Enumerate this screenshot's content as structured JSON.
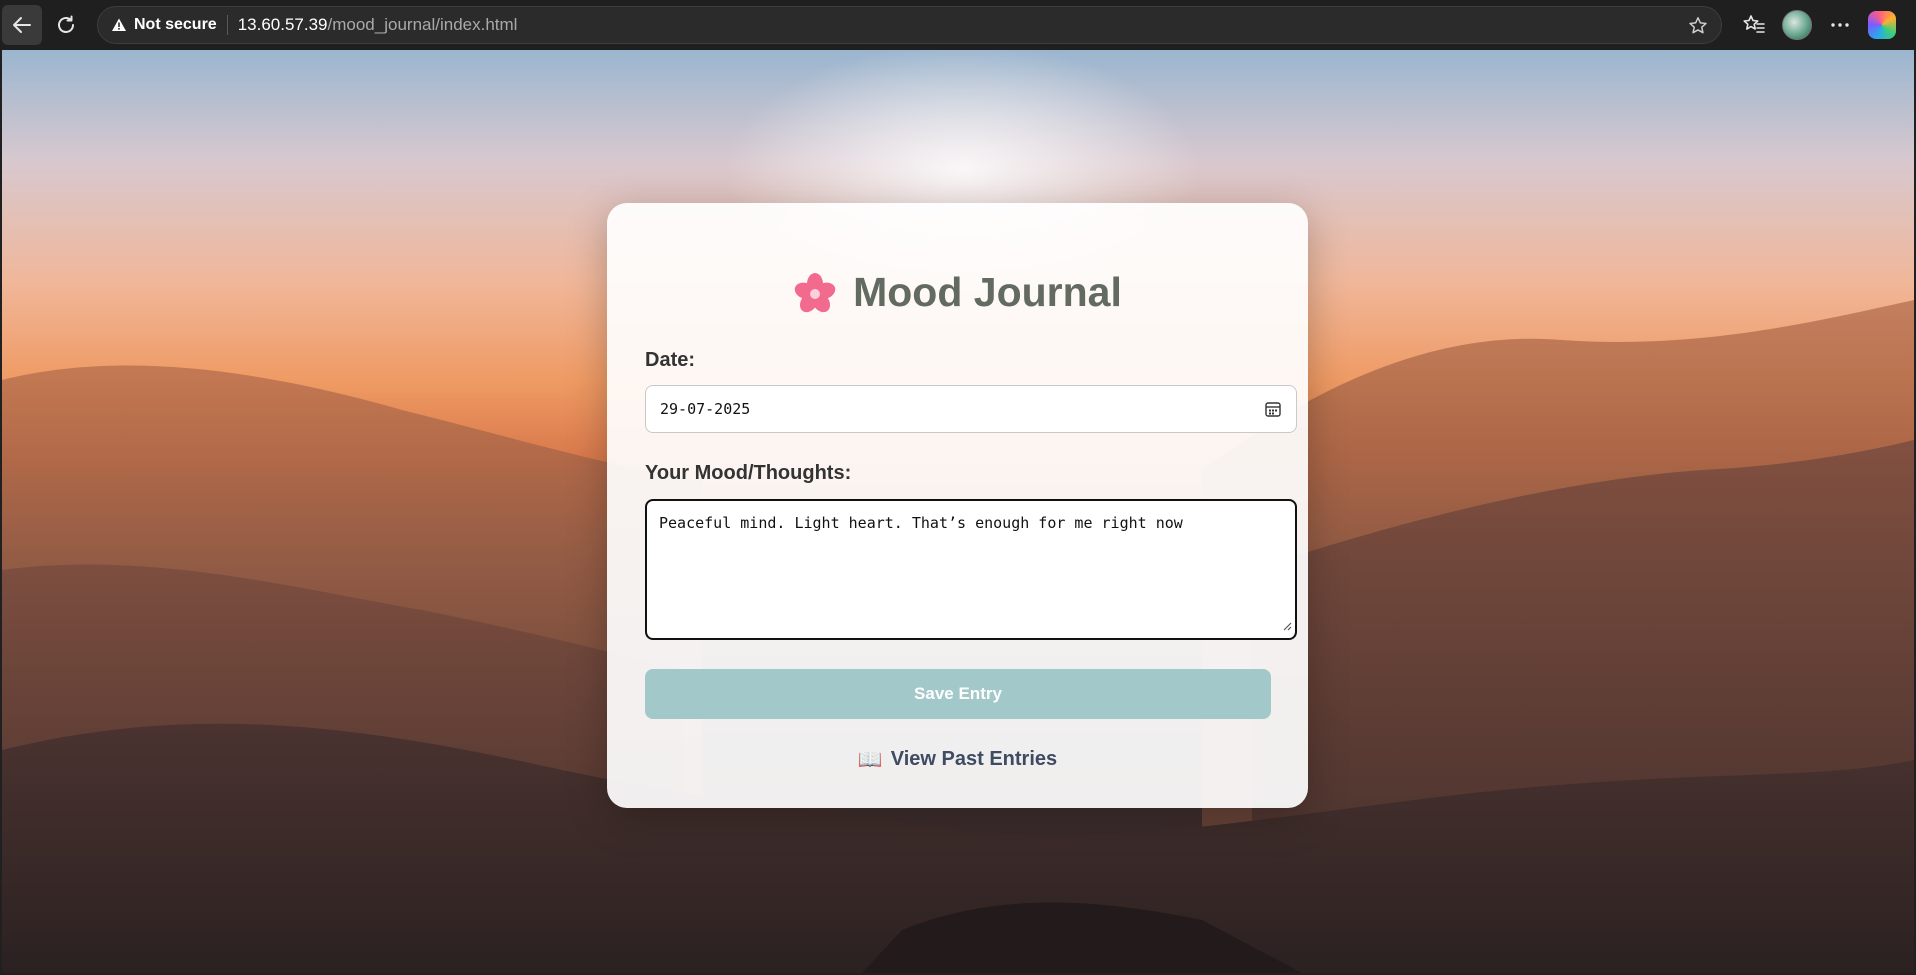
{
  "browser": {
    "security_label": "Not secure",
    "url_host": "13.60.57.39",
    "url_path": "/mood_journal/index.html",
    "icons": [
      "back-arrow-icon",
      "reload-icon",
      "warning-icon",
      "star-icon",
      "favorites-icon",
      "more-icon",
      "copilot-icon"
    ]
  },
  "journal": {
    "title": "Mood Journal",
    "title_icon": "cherry-blossom-icon",
    "date_label": "Date:",
    "date_value": "29-07-2025",
    "mood_label": "Your Mood/Thoughts:",
    "mood_value": "Peaceful mind. Light heart. That’s enough for me right now",
    "save_label": "Save Entry",
    "past_entries_icon": "📖",
    "past_entries_label": "View Past Entries"
  },
  "colors": {
    "title": "#636a5f",
    "save_button": "#a3c8c9",
    "link": "#3f4a63"
  }
}
